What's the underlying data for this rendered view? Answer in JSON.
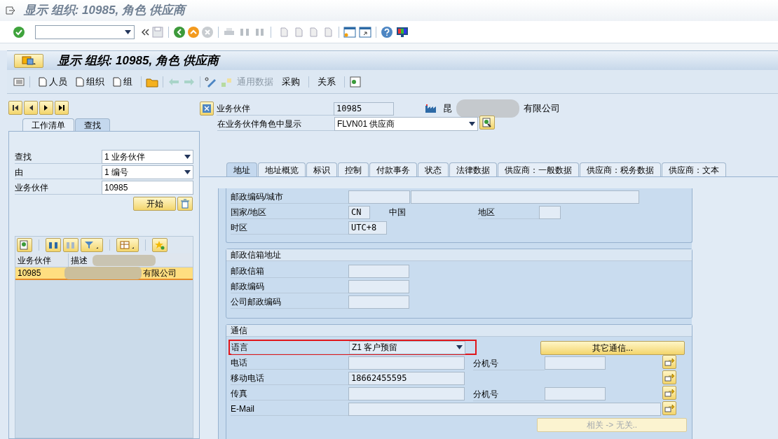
{
  "window": {
    "title": "显示 组织: 10985, 角色 供应商"
  },
  "screen_title": "显示 组织: 10985, 角色 供应商",
  "app_toolbar": [
    {
      "kind": "new",
      "label": "人员",
      "disabled": false
    },
    {
      "kind": "new",
      "label": "组织",
      "disabled": false
    },
    {
      "kind": "new",
      "label": "组",
      "disabled": false
    },
    {
      "kind": "text",
      "label": "通用数据",
      "disabled": true
    },
    {
      "kind": "text",
      "label": "采购",
      "disabled": false
    },
    {
      "kind": "text",
      "label": "关系",
      "disabled": false
    }
  ],
  "left_tabs": [
    {
      "label": "工作清单",
      "selected": false
    },
    {
      "label": "查找",
      "selected": true
    }
  ],
  "search_fields": [
    {
      "kind": "dropdown",
      "label": "查找",
      "value": "1 业务伙伴"
    },
    {
      "kind": "dropdown",
      "label": "由",
      "value": "1 编号"
    },
    {
      "kind": "input",
      "label": "业务伙伴",
      "value": "10985"
    }
  ],
  "start_button": "开始",
  "result_grid": {
    "columns": [
      "业务伙伴",
      "描述"
    ],
    "rows": [
      {
        "cells": [
          "10985",
          "有限公司"
        ],
        "selected": true
      }
    ]
  },
  "partner": {
    "label": "业务伙伴",
    "value": "10985",
    "name_start": "昆",
    "name_end": "有限公司"
  },
  "role": {
    "label": "在业务伙伴角色中显示",
    "value": "FLVN01 供应商"
  },
  "tabs": [
    {
      "label": "地址",
      "selected": true
    },
    {
      "label": "地址概览",
      "selected": false
    },
    {
      "label": "标识",
      "selected": false
    },
    {
      "label": "控制",
      "selected": false
    },
    {
      "label": "付款事务",
      "selected": false
    },
    {
      "label": "状态",
      "selected": false
    },
    {
      "label": "法律数据",
      "selected": false
    },
    {
      "label": "供应商：一般数据",
      "selected": false
    },
    {
      "label": "供应商：税务数据",
      "selected": false
    },
    {
      "label": "供应商：文本",
      "selected": false
    }
  ],
  "address": {
    "postal_city": {
      "label": "邮政编码/城市"
    },
    "country": {
      "label": "国家/地区",
      "code": "CN",
      "name": "中国",
      "region_label": "地区"
    },
    "time_zone": {
      "label": "时区",
      "value": "UTC+8"
    }
  },
  "po_box": {
    "title": "邮政信箱地址",
    "rows": [
      {
        "label": "邮政信箱"
      },
      {
        "label": "邮政编码"
      },
      {
        "label": "公司邮政编码"
      }
    ]
  },
  "communication": {
    "title": "通信",
    "language": {
      "label": "语言",
      "value": "Z1 客户预留",
      "highlighted": true
    },
    "other_button": "其它通信...",
    "rows": [
      {
        "kind": "ext",
        "label": "电话",
        "ext_label": "分机号"
      },
      {
        "kind": "plain",
        "label": "移动电话",
        "value": "18662455595"
      },
      {
        "kind": "ext",
        "label": "传真",
        "ext_label": "分机号"
      },
      {
        "kind": "wide",
        "label": "E-Mail"
      }
    ],
    "relation_button": {
      "label": "相关 -> 无关..",
      "disabled": true
    }
  }
}
